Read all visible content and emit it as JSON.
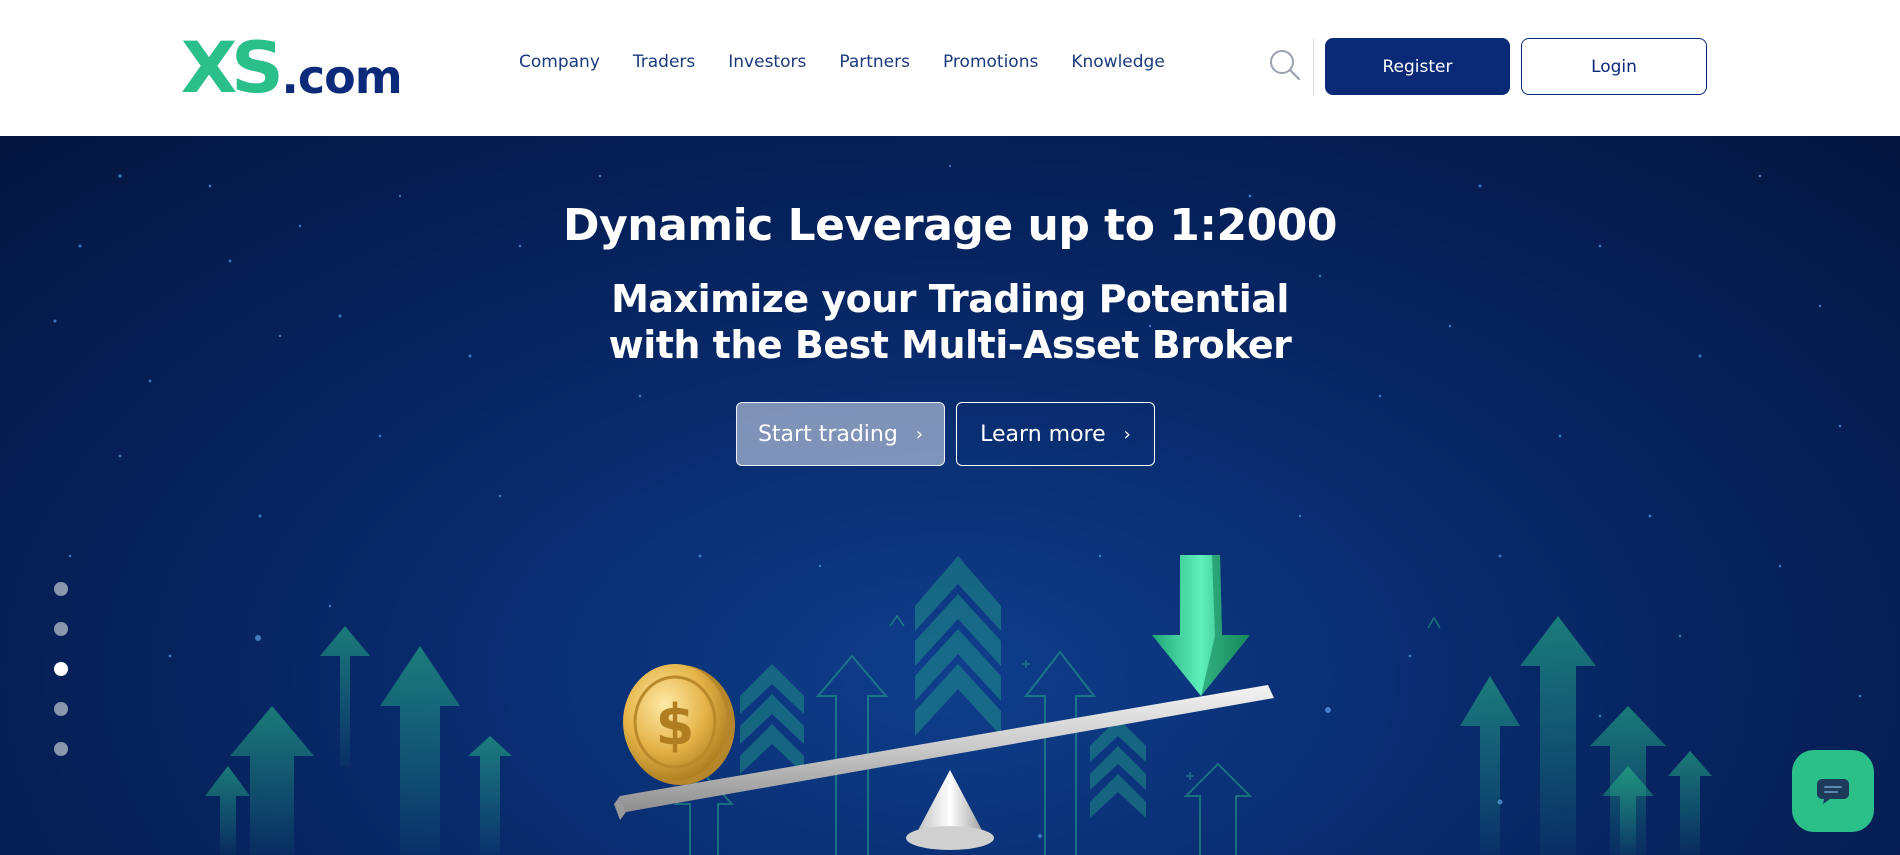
{
  "header": {
    "logo": {
      "brand": "XS",
      "suffix": ".com"
    },
    "nav": [
      {
        "label": "Company"
      },
      {
        "label": "Traders"
      },
      {
        "label": "Investors"
      },
      {
        "label": "Partners"
      },
      {
        "label": "Promotions"
      },
      {
        "label": "Knowledge"
      }
    ],
    "search_icon": "search-icon",
    "register_label": "Register",
    "login_label": "Login"
  },
  "hero": {
    "title": "Dynamic Leverage up to 1:2000",
    "subtitle_line1": "Maximize your Trading Potential",
    "subtitle_line2": "with the Best Multi-Asset Broker",
    "start_label": "Start trading",
    "learn_label": "Learn more",
    "chevron": "›",
    "slider": {
      "count": 5,
      "active_index": 2
    }
  },
  "colors": {
    "brand_green": "#2bbf8a",
    "brand_navy": "#0a2a78",
    "hero_bg": "#082a6b"
  },
  "chat": {
    "icon": "chat-bubble-icon"
  }
}
